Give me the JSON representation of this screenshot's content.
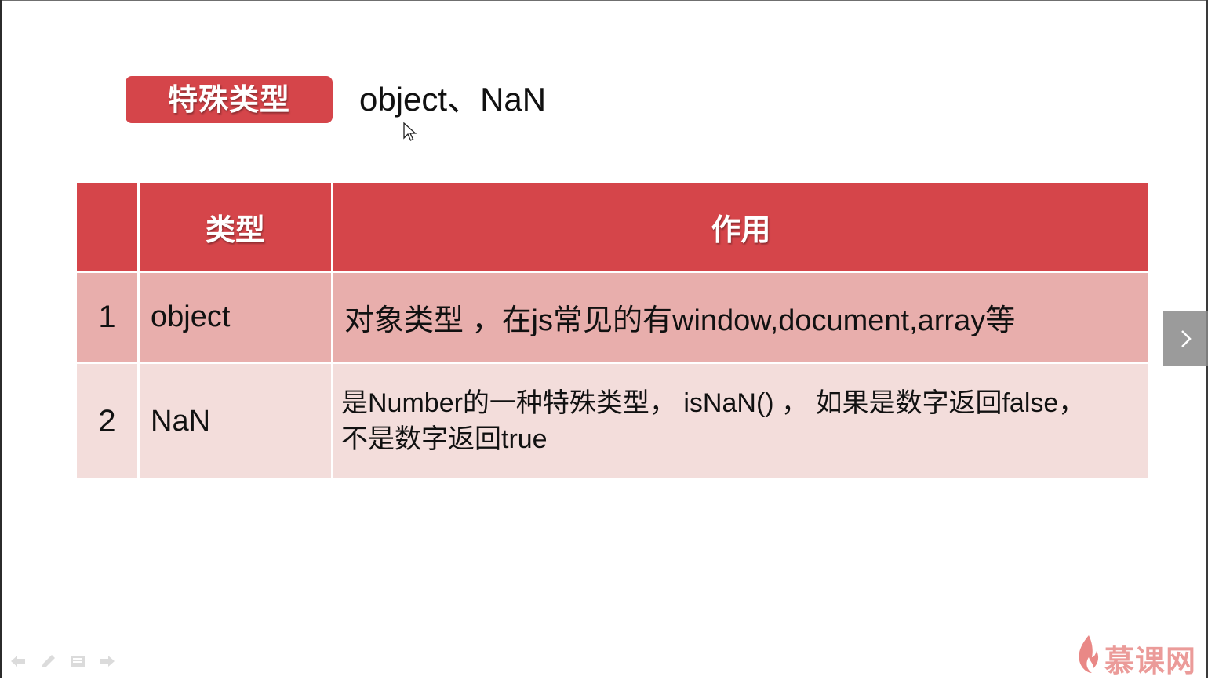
{
  "slide": {
    "title_badge": "特殊类型",
    "title_text": "object、NaN"
  },
  "table": {
    "headers": [
      "",
      "类型",
      "作用"
    ],
    "rows": [
      {
        "index": "1",
        "type": "object",
        "description": "对象类型 ，在js常见的有window,document,array等"
      },
      {
        "index": "2",
        "type": "NaN",
        "description": "是Number的一种特殊类型， isNaN() ， 如果是数字返回false， 不是数字返回true"
      }
    ]
  },
  "controls": {
    "next_icon": "chevron-right-icon",
    "bottom_icons": [
      "back-arrow-icon",
      "pen-icon",
      "menu-icon",
      "forward-arrow-icon"
    ]
  },
  "watermark": {
    "logo_text": "慕课网"
  },
  "colors": {
    "accent_red": "#d5454a",
    "row1_bg": "#e8aeac",
    "row2_bg": "#f3dddb"
  }
}
